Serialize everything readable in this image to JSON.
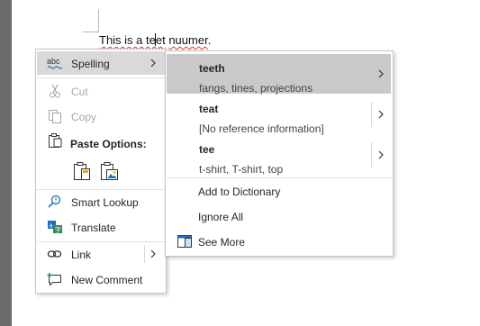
{
  "document": {
    "before": "This is a te",
    "after": "et",
    "space": " ",
    "misspelled2": "nuumer",
    "period": "."
  },
  "context_menu": {
    "spelling_icon": "abc",
    "spelling": "Spelling",
    "cut": "Cut",
    "copy": "Copy",
    "paste_options": "Paste Options:",
    "smart_lookup": "Smart Lookup",
    "translate": "Translate",
    "link": "Link",
    "new_comment": "New Comment"
  },
  "spelling_submenu": {
    "suggestions": [
      {
        "word": "teeth",
        "definition": "fangs, tines, projections"
      },
      {
        "word": "teat",
        "definition": "[No reference information]"
      },
      {
        "word": "tee",
        "definition": "t-shirt, T-shirt, top"
      }
    ],
    "add_to_dictionary": "Add to Dictionary",
    "ignore_all": "Ignore All",
    "see_more": "See More"
  },
  "colors": {
    "highlight": "#d9d9d9",
    "squiggle": "#e0302c",
    "accent_blue": "#1e6fbf",
    "accent_green": "#2e8b57"
  },
  "icons": [
    "spelling-abc-icon",
    "scissors-icon",
    "copy-icon",
    "clipboard-icon",
    "paste-keep-source-icon",
    "paste-picture-icon",
    "smart-lookup-icon",
    "translate-icon",
    "link-icon",
    "new-comment-icon",
    "see-more-icon",
    "chevron-right-icon"
  ]
}
